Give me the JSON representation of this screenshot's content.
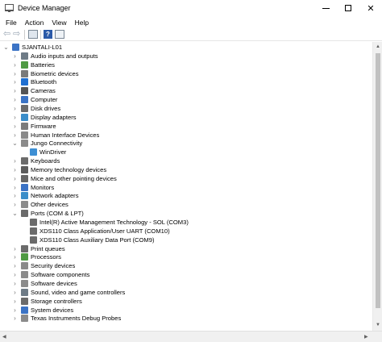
{
  "window": {
    "title": "Device Manager",
    "close_glyph": "✕"
  },
  "menu": [
    "File",
    "Action",
    "View",
    "Help"
  ],
  "toolbar": {
    "back_glyph": "⇦",
    "forward_glyph": "⇨",
    "help_glyph": "?"
  },
  "tree": [
    {
      "label": "SJANTALI-L01",
      "level": 0,
      "state": "expanded",
      "icon": "computer-icon",
      "color": "#3b73c5"
    },
    {
      "label": "Audio inputs and outputs",
      "level": 1,
      "state": "collapsed",
      "icon": "speaker-icon",
      "color": "#6e7b86"
    },
    {
      "label": "Batteries",
      "level": 1,
      "state": "collapsed",
      "icon": "battery-icon",
      "color": "#4f9a43"
    },
    {
      "label": "Biometric devices",
      "level": 1,
      "state": "collapsed",
      "icon": "fingerprint-icon",
      "color": "#7a7a7a"
    },
    {
      "label": "Bluetooth",
      "level": 1,
      "state": "collapsed",
      "icon": "bluetooth-icon",
      "color": "#1f6fd1"
    },
    {
      "label": "Cameras",
      "level": 1,
      "state": "collapsed",
      "icon": "camera-icon",
      "color": "#555555"
    },
    {
      "label": "Computer",
      "level": 1,
      "state": "collapsed",
      "icon": "monitor-icon",
      "color": "#3b73c5"
    },
    {
      "label": "Disk drives",
      "level": 1,
      "state": "collapsed",
      "icon": "disk-icon",
      "color": "#6b6b6b"
    },
    {
      "label": "Display adapters",
      "level": 1,
      "state": "collapsed",
      "icon": "display-adapter-icon",
      "color": "#3a8dc9"
    },
    {
      "label": "Firmware",
      "level": 1,
      "state": "collapsed",
      "icon": "chip-icon",
      "color": "#7b7b7b"
    },
    {
      "label": "Human Interface Devices",
      "level": 1,
      "state": "collapsed",
      "icon": "hid-icon",
      "color": "#8a8a8a"
    },
    {
      "label": "Jungo Connectivity",
      "level": 1,
      "state": "expanded",
      "icon": "device-icon",
      "color": "#8b8b8b"
    },
    {
      "label": "WinDriver",
      "level": 2,
      "state": "leaf",
      "icon": "device-icon",
      "color": "#3d8fd4"
    },
    {
      "label": "Keyboards",
      "level": 1,
      "state": "collapsed",
      "icon": "keyboard-icon",
      "color": "#6b6b6b"
    },
    {
      "label": "Memory technology devices",
      "level": 1,
      "state": "collapsed",
      "icon": "memory-icon",
      "color": "#5c5c5c"
    },
    {
      "label": "Mice and other pointing devices",
      "level": 1,
      "state": "collapsed",
      "icon": "mouse-icon",
      "color": "#666666"
    },
    {
      "label": "Monitors",
      "level": 1,
      "state": "collapsed",
      "icon": "monitor-icon",
      "color": "#3b73c5"
    },
    {
      "label": "Network adapters",
      "level": 1,
      "state": "collapsed",
      "icon": "network-icon",
      "color": "#3a8dc9"
    },
    {
      "label": "Other devices",
      "level": 1,
      "state": "collapsed",
      "icon": "unknown-device-icon",
      "color": "#8b8b8b"
    },
    {
      "label": "Ports (COM & LPT)",
      "level": 1,
      "state": "expanded",
      "icon": "port-icon",
      "color": "#6b6b6b"
    },
    {
      "label": "Intel(R) Active Management Technology - SOL (COM3)",
      "level": 2,
      "state": "leaf",
      "icon": "port-icon",
      "color": "#6b6b6b"
    },
    {
      "label": "XDS110 Class Application/User UART (COM10)",
      "level": 2,
      "state": "leaf",
      "icon": "port-icon",
      "color": "#6b6b6b"
    },
    {
      "label": "XDS110 Class Auxiliary Data Port (COM9)",
      "level": 2,
      "state": "leaf",
      "icon": "port-icon",
      "color": "#6b6b6b"
    },
    {
      "label": "Print queues",
      "level": 1,
      "state": "collapsed",
      "icon": "printer-icon",
      "color": "#6b6b6b"
    },
    {
      "label": "Processors",
      "level": 1,
      "state": "collapsed",
      "icon": "processor-icon",
      "color": "#4f9a43"
    },
    {
      "label": "Security devices",
      "level": 1,
      "state": "collapsed",
      "icon": "security-icon",
      "color": "#8a8a8a"
    },
    {
      "label": "Software components",
      "level": 1,
      "state": "collapsed",
      "icon": "puzzle-icon",
      "color": "#8b8b8b"
    },
    {
      "label": "Software devices",
      "level": 1,
      "state": "collapsed",
      "icon": "software-icon",
      "color": "#8b8b8b"
    },
    {
      "label": "Sound, video and game controllers",
      "level": 1,
      "state": "collapsed",
      "icon": "speaker-icon",
      "color": "#6e7b86"
    },
    {
      "label": "Storage controllers",
      "level": 1,
      "state": "collapsed",
      "icon": "storage-icon",
      "color": "#6b6b6b"
    },
    {
      "label": "System devices",
      "level": 1,
      "state": "collapsed",
      "icon": "system-icon",
      "color": "#3b73c5"
    },
    {
      "label": "Texas Instruments Debug Probes",
      "level": 1,
      "state": "collapsed",
      "icon": "device-icon",
      "color": "#8b8b8b"
    }
  ]
}
